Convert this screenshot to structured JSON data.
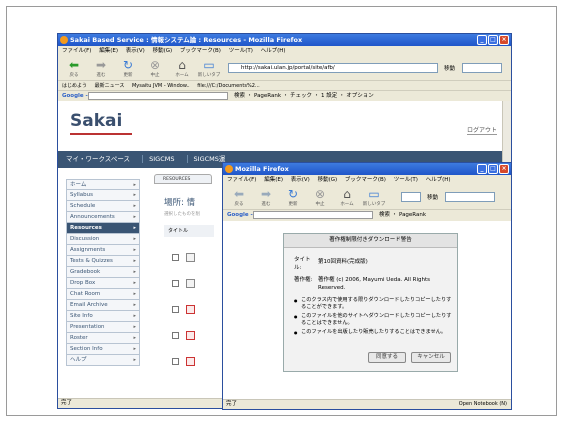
{
  "back_window": {
    "title": "Sakai Based Service : 情報システム論 : Resources - Mozilla Firefox",
    "menu": [
      "ファイル(F)",
      "編集(E)",
      "表示(V)",
      "移動(G)",
      "ブックマーク(B)",
      "ツール(T)",
      "ヘルプ(H)"
    ],
    "nav_buttons": [
      "戻る",
      "進む",
      "更新",
      "中止",
      "ホーム",
      "新しいタブ"
    ],
    "url": "http://sakai.ulan.jp/portal/site/afb/",
    "go_label": "移動",
    "bookmarks": [
      "はじめよう",
      "最新ニュース",
      "Mysaitu JVM - Window..",
      "file:///C:/Documents%2..."
    ],
    "google_bar": "Google -",
    "google_tools": "検索 ・ PageRank ・ チェック ・ 1 設定 ・ オプション",
    "logo": "Sakai",
    "logout": "ログアウト",
    "site_tabs": [
      "マイ・ワークスペース",
      "SIGCMS",
      "SIGCMS運"
    ],
    "tools": [
      "ホーム",
      "Syllabus",
      "Schedule",
      "Announcements",
      "Resources",
      "Discussion",
      "Assignments",
      "Tests & Quizzes",
      "Gradebook",
      "Drop Box",
      "Chat Room",
      "Email Archive",
      "Site Info",
      "Presentation",
      "Roster",
      "Section Info",
      "ヘルプ"
    ],
    "active_tool": "Resources",
    "resources_tab": "RESOURCES",
    "location": "場所: 情",
    "hint": "選択したものを削",
    "table_header": "タイトル",
    "status": "完了"
  },
  "front_window": {
    "title": "Mozilla Firefox",
    "menu": [
      "ファイル(F)",
      "編集(E)",
      "表示(V)",
      "移動(G)",
      "ブックマーク(B)",
      "ツール(T)",
      "ヘルプ(H)"
    ],
    "nav_buttons": [
      "戻る",
      "進む",
      "更新",
      "中止",
      "ホーム",
      "新しいタブ"
    ],
    "go_label": "移動",
    "google_bar": "Google -",
    "google_tools": "検索 ・ PageRank",
    "status": "完了",
    "status_right": "Open Notebook (N)",
    "dialog": {
      "title": "著作権制限付きダウンロード警告",
      "title_label": "タイトル:",
      "title_value": "第10回資料(完成版)",
      "copyright_label": "著作権:",
      "copyright_value": "著作権 (c) 2006, Mayumi Ueda. All Rights Reserved.",
      "bullets": [
        "このクラス内で使用する限りダウンロードしたりコピーしたりすることができます。",
        "このファイルを他のサイトへダウンロードしたりコピーしたりすることはできません。",
        "このファイルを出版したり販売したりすることはできません。"
      ],
      "accept": "同意する",
      "cancel": "キャンセル"
    }
  }
}
